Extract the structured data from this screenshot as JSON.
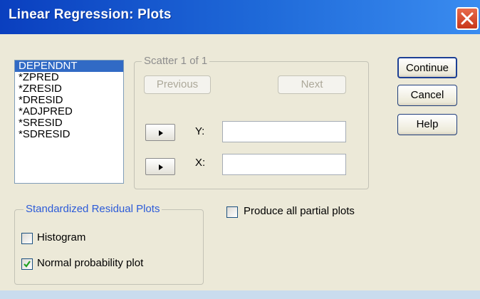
{
  "window": {
    "title": "Linear Regression: Plots",
    "close_icon": "close-icon"
  },
  "variables": {
    "items": [
      "DEPENDNT",
      "*ZPRED",
      "*ZRESID",
      "*DRESID",
      "*ADJPRED",
      "*SRESID",
      "*SDRESID"
    ],
    "selected_index": 0
  },
  "scatter": {
    "legend": "Scatter 1 of 1",
    "previous_label": "Previous",
    "next_label": "Next",
    "y_label": "Y:",
    "x_label": "X:",
    "y_value": "",
    "x_value": ""
  },
  "buttons": {
    "continue_label": "Continue",
    "cancel_label": "Cancel",
    "help_label": "Help"
  },
  "standardized": {
    "legend": "Standardized Residual Plots",
    "histogram_label": "Histogram",
    "histogram_checked": false,
    "normal_label": "Normal probability plot",
    "normal_checked": true
  },
  "partial_plots": {
    "label": "Produce all partial plots",
    "checked": false
  },
  "colors": {
    "title_bar": "#1f5fd0",
    "selection": "#316ac5",
    "group_legend": "#2c5bd8",
    "close_button": "#d84a2a"
  }
}
